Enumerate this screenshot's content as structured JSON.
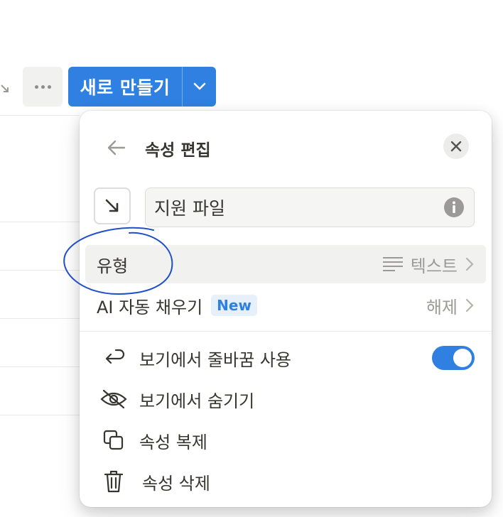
{
  "toolbar": {
    "more_icon": "more-horizontal-icon",
    "new_label": "새로 만들기",
    "caret_icon": "chevron-down-icon"
  },
  "panel": {
    "title": "속성 편집",
    "back_icon": "arrow-left-icon",
    "close_icon": "close-icon",
    "property_icon": "arrow-down-right-icon",
    "name_value": "지원 파일",
    "info_icon": "info-icon"
  },
  "rows": {
    "type": {
      "label": "유형",
      "value": "텍스트",
      "icon": "text-lines-icon"
    },
    "ai_fill": {
      "label": "AI 자동 채우기",
      "badge": "New",
      "value": "해제"
    }
  },
  "menu": {
    "wrap": {
      "label": "보기에서 줄바꿈 사용",
      "icon": "wrap-arrow-icon",
      "toggle_on": true
    },
    "hide": {
      "label": "보기에서 숨기기",
      "icon": "eye-off-icon"
    },
    "duplicate": {
      "label": "속성 복제",
      "icon": "copy-icon"
    },
    "delete": {
      "label": "속성 삭제",
      "icon": "trash-icon"
    }
  },
  "colors": {
    "accent": "#2f80e0",
    "annotation": "#1f4fc9"
  }
}
